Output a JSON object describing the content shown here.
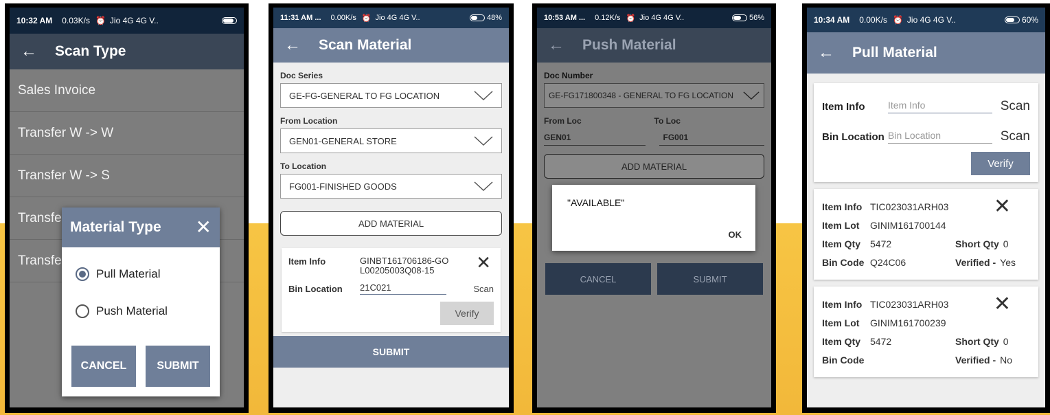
{
  "phone1": {
    "status": {
      "time": "10:32 AM",
      "speed": "0.03K/s",
      "carrier": "Jio 4G 4G V.."
    },
    "title": "Scan Type",
    "list": [
      "Sales Invoice",
      "Transfer W -> W",
      "Transfer W -> S",
      "Transfe",
      "Transfe"
    ],
    "dialog": {
      "title": "Material Type",
      "options": [
        "Pull Material",
        "Push Material"
      ],
      "cancel": "CANCEL",
      "submit": "SUBMIT"
    }
  },
  "phone2": {
    "status": {
      "time": "11:31 AM ...",
      "speed": "0.00K/s",
      "carrier": "Jio 4G 4G V..",
      "battery": "48%"
    },
    "title": "Scan Material",
    "doc_series_label": "Doc Series",
    "doc_series_value": "GE-FG-GENERAL TO FG LOCATION",
    "from_label": "From Location",
    "from_value": "GEN01-GENERAL STORE",
    "to_label": "To Location",
    "to_value": "FG001-FINISHED GOODS",
    "add_material": "ADD MATERIAL",
    "item_info_label": "Item Info",
    "item_info_value": "GINBT161706186-GOL00205003Q08-15",
    "bin_label": "Bin Location",
    "bin_value": "21C021",
    "scan": "Scan",
    "verify": "Verify",
    "submit": "SUBMIT"
  },
  "phone3": {
    "status": {
      "time": "10:53 AM ...",
      "speed": "0.12K/s",
      "carrier": "Jio 4G 4G V..",
      "battery": "56%"
    },
    "title": "Push Material",
    "doc_number_label": "Doc Number",
    "doc_number_value": "GE-FG171800348 - GENERAL TO FG LOCATION",
    "from_loc_label": "From Loc",
    "to_loc_label": "To Loc",
    "from_loc_value": "GEN01",
    "to_loc_value": "FG001",
    "add_material": "ADD MATERIAL",
    "alert_message": "\"AVAILABLE\"",
    "alert_ok": "OK",
    "cancel": "CANCEL",
    "submit": "SUBMIT"
  },
  "phone4": {
    "status": {
      "time": "10:34 AM",
      "speed": "0.00K/s",
      "carrier": "Jio 4G 4G V..",
      "battery": "60%"
    },
    "title": "Pull Material",
    "item_info_label": "Item Info",
    "item_info_placeholder": "Item Info",
    "bin_label": "Bin Location",
    "bin_placeholder": "Bin Location",
    "scan": "Scan",
    "verify": "Verify",
    "items": [
      {
        "info_label": "Item Info",
        "info": "TIC023031ARH03",
        "lot_label": "Item Lot",
        "lot": "GINIM161700144",
        "qty_label": "Item Qty",
        "qty": "5472",
        "short_label": "Short Qty",
        "short": "0",
        "bin_label": "Bin Code",
        "bin": "Q24C06",
        "verified_label": "Verified -",
        "verified": "Yes"
      },
      {
        "info_label": "Item Info",
        "info": "TIC023031ARH03",
        "lot_label": "Item Lot",
        "lot": "GINIM161700239",
        "qty_label": "Item Qty",
        "qty": "5472",
        "short_label": "Short Qty",
        "short": "0",
        "bin_label": "Bin Code",
        "bin": "",
        "verified_label": "Verified -",
        "verified": "No"
      }
    ]
  }
}
